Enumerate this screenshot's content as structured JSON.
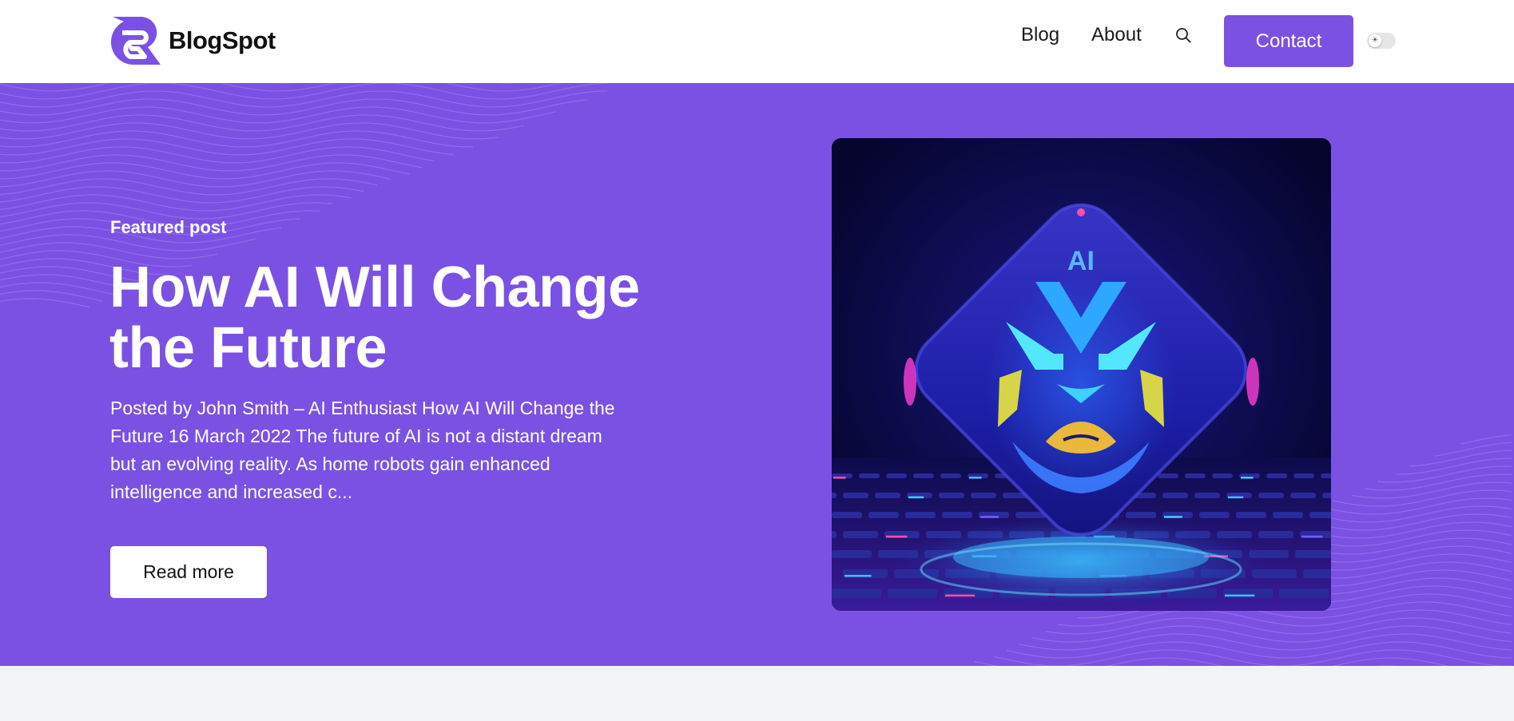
{
  "header": {
    "logo_text": "BlogSpot",
    "logo_icon": "blogspot-logo",
    "nav": {
      "blog": "Blog",
      "about": "About"
    },
    "search_icon": "search-icon",
    "contact_label": "Contact",
    "theme_toggle_icon": "sun-icon",
    "theme_toggle_glyph": "☀"
  },
  "hero": {
    "tag": "Featured post",
    "title": "How AI Will Change the Future",
    "excerpt": "Posted by John Smith – AI Enthusiast How AI Will Change the Future 16 March 2022 The future of AI is not a distant dream but an evolving reality. As home robots gain enhanced intelligence and increased c...",
    "read_more_label": "Read more",
    "image": {
      "badge_text": "AI"
    }
  },
  "colors": {
    "accent": "#7b51e4",
    "header_bg": "#ffffff",
    "page_bg": "#f2f3f5"
  }
}
